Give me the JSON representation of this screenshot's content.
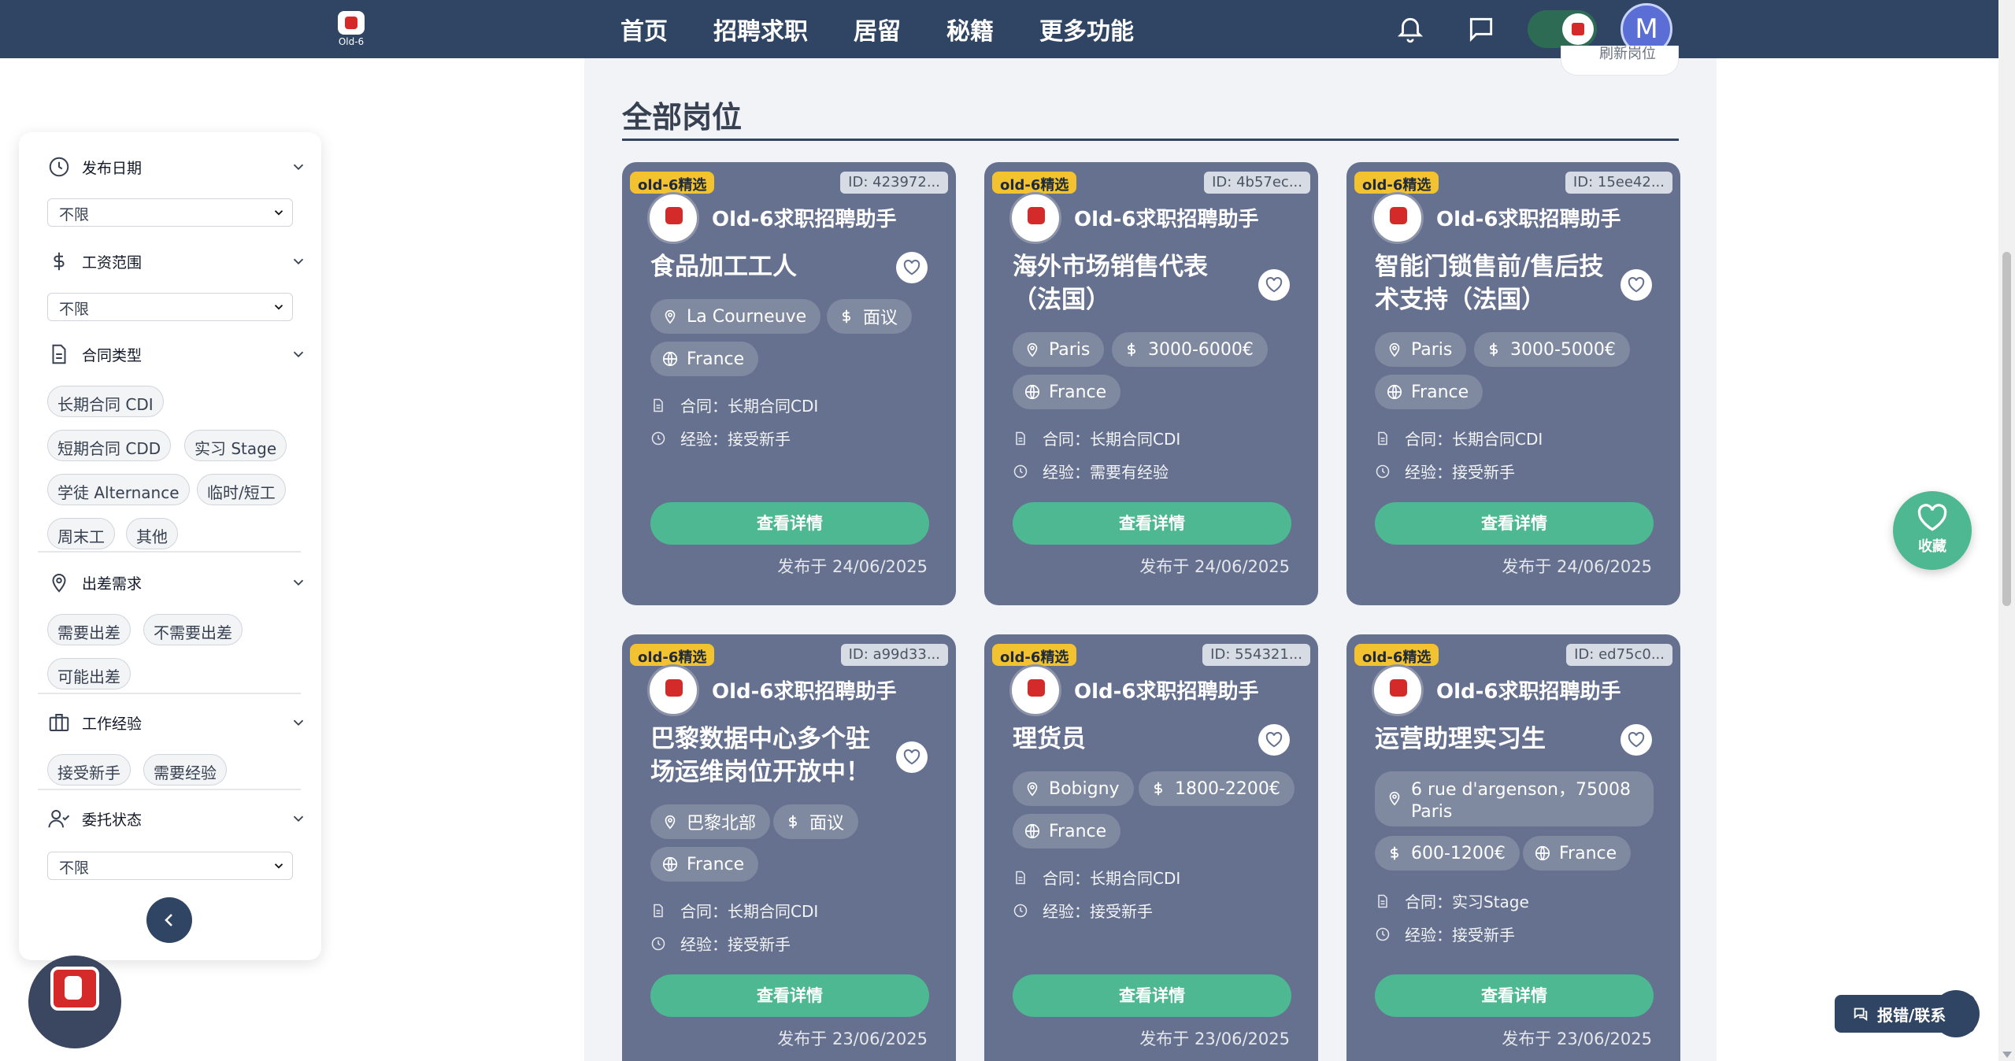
{
  "brand": {
    "logo_text": "Old-6"
  },
  "nav": {
    "items": [
      "首页",
      "招聘求职",
      "居留",
      "秘籍",
      "更多功能"
    ]
  },
  "user": {
    "avatar_letter": "M"
  },
  "filters": {
    "publish_date": {
      "label": "发布日期",
      "value": "不限"
    },
    "salary": {
      "label": "工资范围",
      "value": "不限"
    },
    "contract": {
      "label": "合同类型",
      "options": [
        "长期合同 CDI",
        "短期合同 CDD",
        "实习 Stage",
        "学徒 Alternance",
        "临时/短工",
        "周末工",
        "其他"
      ]
    },
    "travel": {
      "label": "出差需求",
      "options": [
        "需要出差",
        "不需要出差",
        "可能出差"
      ]
    },
    "experience": {
      "label": "工作经验",
      "options": [
        "接受新手",
        "需要经验"
      ]
    },
    "delegation": {
      "label": "委托状态",
      "value": "不限"
    }
  },
  "main": {
    "section_title": "全部岗位",
    "refresh_label": "刷新岗位"
  },
  "cards": [
    {
      "badge": "old-6精选",
      "id": "ID: 423972...",
      "recruiter": "Old-6求职招聘助手",
      "title": "食品加工工人",
      "location": "La Courneuve",
      "salary": "面议",
      "country": "France",
      "contract": "合同：长期合同CDI",
      "experience": "经验：接受新手",
      "button": "查看详情",
      "posted": "发布于 24/06/2025"
    },
    {
      "badge": "old-6精选",
      "id": "ID: 4b57ec...",
      "recruiter": "Old-6求职招聘助手",
      "title": "海外市场销售代表（法国）",
      "location": "Paris",
      "salary": "3000-6000€",
      "country": "France",
      "contract": "合同：长期合同CDI",
      "experience": "经验：需要有经验",
      "button": "查看详情",
      "posted": "发布于 24/06/2025"
    },
    {
      "badge": "old-6精选",
      "id": "ID: 15ee42...",
      "recruiter": "Old-6求职招聘助手",
      "title": "智能门锁售前/售后技术支持（法国）",
      "location": "Paris",
      "salary": "3000-5000€",
      "country": "France",
      "contract": "合同：长期合同CDI",
      "experience": "经验：接受新手",
      "button": "查看详情",
      "posted": "发布于 24/06/2025"
    },
    {
      "badge": "old-6精选",
      "id": "ID: a99d33...",
      "recruiter": "Old-6求职招聘助手",
      "title": "巴黎数据中心多个驻场运维岗位开放中！",
      "location": "巴黎北部",
      "salary": "面议",
      "country": "France",
      "contract": "合同：长期合同CDI",
      "experience": "经验：接受新手",
      "button": "查看详情",
      "posted": "发布于 23/06/2025"
    },
    {
      "badge": "old-6精选",
      "id": "ID: 554321...",
      "recruiter": "Old-6求职招聘助手",
      "title": "理货员",
      "location": "Bobigny",
      "salary": "1800-2200€",
      "country": "France",
      "contract": "合同：长期合同CDI",
      "experience": "经验：接受新手",
      "button": "查看详情",
      "posted": "发布于 23/06/2025"
    },
    {
      "badge": "old-6精选",
      "id": "ID: ed75c0...",
      "recruiter": "Old-6求职招聘助手",
      "title": "运营助理实习生",
      "location": "6 rue d'argenson，75008 Paris",
      "salary": "600-1200€",
      "country": "France",
      "contract": "合同：实习Stage",
      "experience": "经验：接受新手",
      "button": "查看详情",
      "posted": "发布于 23/06/2025"
    }
  ],
  "floating": {
    "favorites_label": "收藏",
    "report_label": "报错/联系"
  },
  "colors": {
    "nav_bg": "#2f4563",
    "card_bg": "#65718f",
    "accent_green": "#4db892",
    "badge_yellow": "#f2c230"
  }
}
